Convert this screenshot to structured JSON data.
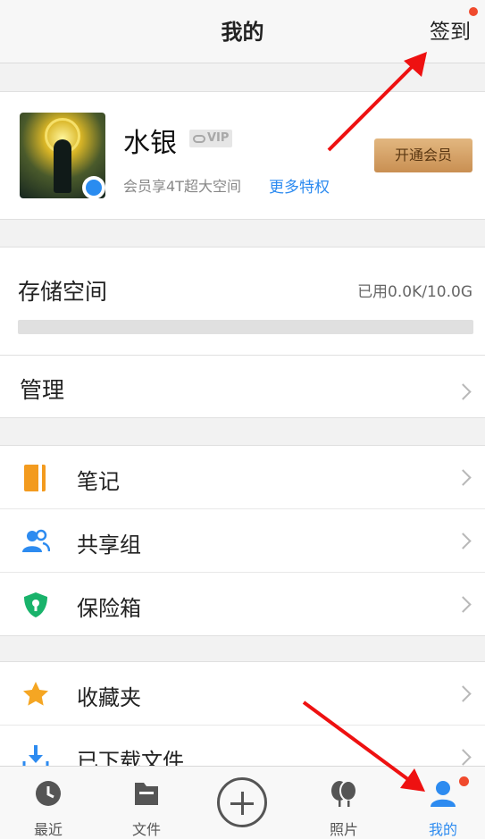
{
  "header": {
    "title": "我的",
    "signin_label": "签到"
  },
  "profile": {
    "username": "水银",
    "vip_badge": "VIP",
    "member_desc": "会员享4T超大空间",
    "more_privileges": "更多特权",
    "open_vip_button": "开通会员"
  },
  "storage": {
    "label": "存储空间",
    "usage_text": "已用0.0K/10.0G",
    "usage_fraction": 0.0,
    "manage_label": "管理"
  },
  "menu_group1": [
    {
      "label": "笔记",
      "icon": "notebook-icon"
    },
    {
      "label": "共享组",
      "icon": "group-users-icon"
    },
    {
      "label": "保险箱",
      "icon": "shield-lock-icon"
    }
  ],
  "menu_group2": [
    {
      "label": "收藏夹",
      "icon": "star-icon"
    },
    {
      "label": "已下载文件",
      "icon": "download-icon"
    }
  ],
  "tabs": [
    {
      "label": "最近",
      "icon": "clock-icon"
    },
    {
      "label": "文件",
      "icon": "folder-icon"
    },
    {
      "label": "照片",
      "icon": "photos-icon"
    },
    {
      "label": "我的",
      "icon": "user-icon",
      "active": true
    }
  ],
  "colors": {
    "accent": "#2d8bf0",
    "badge_dot": "#f04a2d",
    "vip_gold": "#d9a15f",
    "arrow": "#ee1111"
  }
}
